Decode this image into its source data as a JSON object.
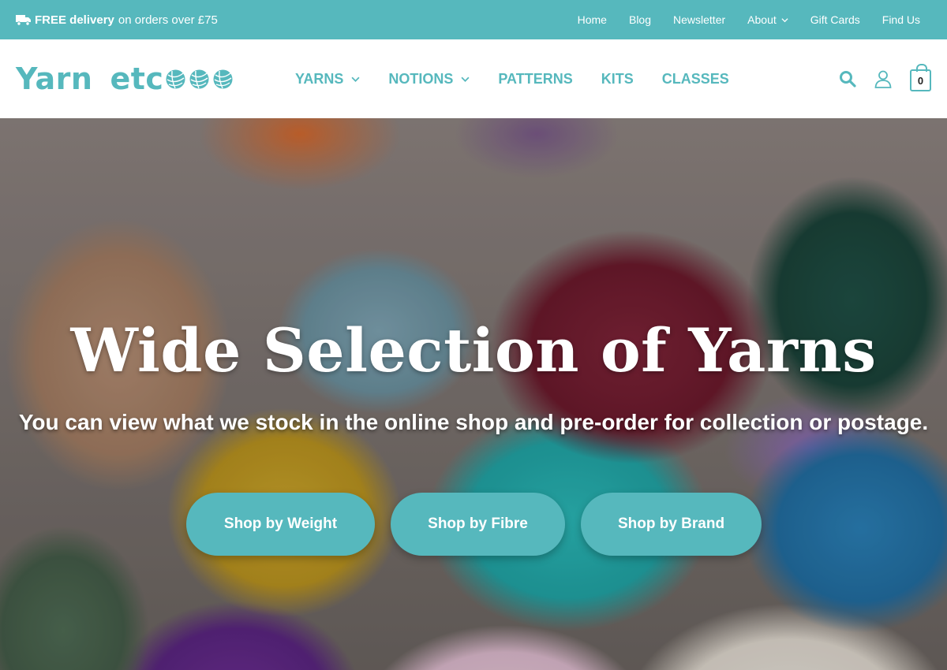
{
  "topbar": {
    "promo_bold": "FREE delivery",
    "promo_rest": "on orders over £75",
    "links": [
      "Home",
      "Blog",
      "Newsletter",
      "About",
      "Gift Cards",
      "Find Us"
    ]
  },
  "header": {
    "logo_word1": "Yarn",
    "logo_word2": "etc",
    "nav": [
      "YARNS",
      "NOTIONS",
      "PATTERNS",
      "KITS",
      "CLASSES"
    ],
    "cart_count": "0"
  },
  "hero": {
    "title": "Wide Selection of Yarns",
    "subtitle": "You can view what we stock in the online shop and pre-order for collection or postage.",
    "buttons": [
      "Shop by Weight",
      "Shop by Fibre",
      "Shop by Brand"
    ]
  },
  "colors": {
    "brand": "#56b8bd"
  },
  "icons": [
    "truck-icon",
    "chevron-down-icon",
    "search-icon",
    "user-icon",
    "cart-icon",
    "yarn-ball-icon"
  ]
}
